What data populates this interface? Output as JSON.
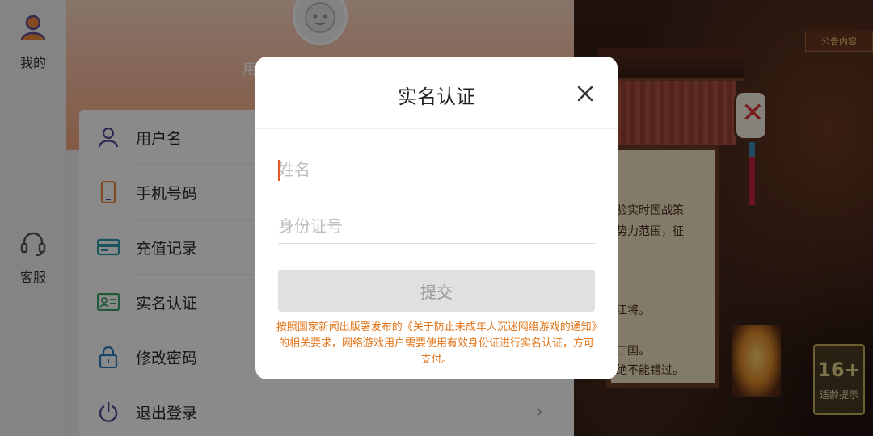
{
  "background": {
    "badge_top": "公告内容",
    "notice_lines": [
      "验实时国战策",
      "势力范围，征",
      "江将。",
      "三国。",
      "绝不能错过。"
    ],
    "age_rating": {
      "number": "16+",
      "label": "适龄提示"
    }
  },
  "rail": {
    "items": [
      {
        "label": "我的",
        "icon": "user-icon"
      },
      {
        "label": "客服",
        "icon": "headset-icon"
      }
    ]
  },
  "panel": {
    "header": {
      "username_partial": "用"
    },
    "menu": [
      {
        "label": "用户名",
        "icon": "user-outline-icon"
      },
      {
        "label": "手机号码",
        "icon": "phone-icon"
      },
      {
        "label": "充值记录",
        "icon": "card-icon"
      },
      {
        "label": "实名认证",
        "icon": "id-card-icon"
      },
      {
        "label": "修改密码",
        "icon": "lock-icon"
      },
      {
        "label": "退出登录",
        "icon": "power-icon"
      }
    ]
  },
  "dialog": {
    "title": "实名认证",
    "name_placeholder": "姓名",
    "id_placeholder": "身份证号",
    "submit_label": "提交",
    "notice": "按照国家新闻出版署发布的《关于防止未成年人沉迷网络游戏的通知》的相关要求，网络游戏用户需要使用有效身份证进行实名认证，方可支付。"
  },
  "colors": {
    "accent_orange": "#e2761b",
    "caret": "#e85a2a",
    "icon_purple": "#5b4b9a",
    "header_peach": "#f6b89a"
  }
}
